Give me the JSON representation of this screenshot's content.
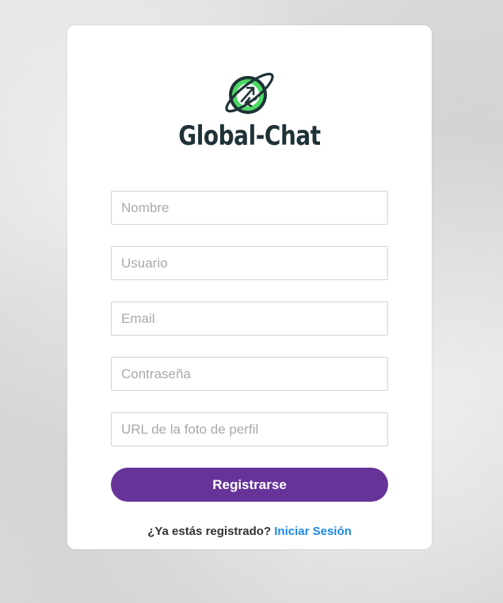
{
  "brand": {
    "name": "Global-Chat",
    "logo_icon": "globe-arrows-icon",
    "colors": {
      "text": "#1f3238",
      "globe": "#4cd964",
      "ring": "#1f3238"
    }
  },
  "form": {
    "fields": [
      {
        "name": "nombre",
        "placeholder": "Nombre",
        "value": ""
      },
      {
        "name": "usuario",
        "placeholder": "Usuario",
        "value": ""
      },
      {
        "name": "email",
        "placeholder": "Email",
        "value": ""
      },
      {
        "name": "password",
        "placeholder": "Contraseña",
        "value": ""
      },
      {
        "name": "photo_url",
        "placeholder": "URL de la foto de perfil",
        "value": ""
      }
    ],
    "submit_label": "Registrarse",
    "submit_color": "#663399"
  },
  "footer": {
    "prompt": "¿Ya estás registrado?",
    "link_label": "Iniciar Sesión",
    "link_color": "#1e88e5"
  }
}
